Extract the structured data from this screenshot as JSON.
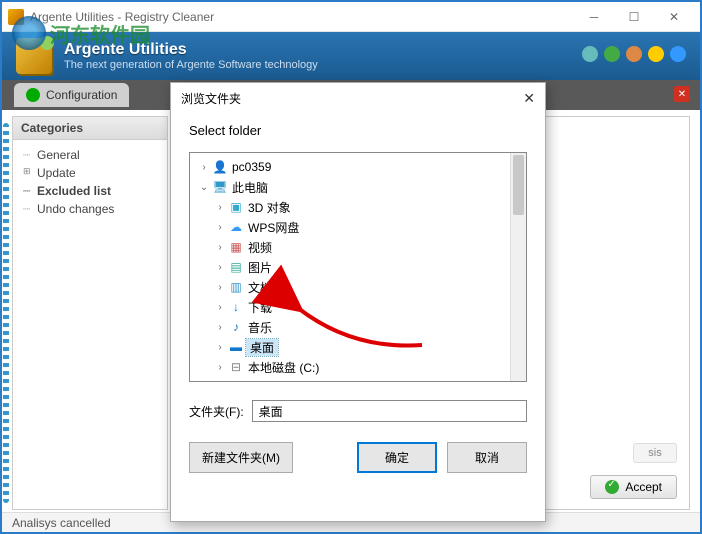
{
  "window": {
    "title": "Argente Utilities - Registry Cleaner",
    "min": "─",
    "max": "☐",
    "close": "✕"
  },
  "watermark": {
    "text": "河东软件园"
  },
  "banner": {
    "title": "Argente Utilities",
    "subtitle": "The next generation of Argente Software technology"
  },
  "tab": {
    "label": "Configuration"
  },
  "sidebar": {
    "header": "Categories",
    "items": [
      "General",
      "Update",
      "Excluded list",
      "Undo changes"
    ]
  },
  "content": {
    "accept": "Accept",
    "ghost": "sis"
  },
  "status": {
    "text": "Analisys cancelled"
  },
  "dialog": {
    "title": "浏览文件夹",
    "close": "✕",
    "heading": "Select folder",
    "folder_label": "文件夹(F):",
    "folder_value": "桌面",
    "new_folder": "新建文件夹(M)",
    "ok": "确定",
    "cancel": "取消",
    "tree": [
      {
        "depth": 0,
        "exp": "closed",
        "icon": "user",
        "glyph": "👤",
        "label": "pc0359"
      },
      {
        "depth": 0,
        "exp": "open",
        "icon": "pc",
        "glyph": "🖥",
        "label": "此电脑"
      },
      {
        "depth": 1,
        "exp": "closed",
        "icon": "3d",
        "glyph": "▣",
        "label": "3D 对象"
      },
      {
        "depth": 1,
        "exp": "closed",
        "icon": "cloud",
        "glyph": "☁",
        "label": "WPS网盘"
      },
      {
        "depth": 1,
        "exp": "closed",
        "icon": "video",
        "glyph": "▦",
        "label": "视频"
      },
      {
        "depth": 1,
        "exp": "closed",
        "icon": "pic",
        "glyph": "▤",
        "label": "图片"
      },
      {
        "depth": 1,
        "exp": "closed",
        "icon": "doc",
        "glyph": "▥",
        "label": "文档"
      },
      {
        "depth": 1,
        "exp": "closed",
        "icon": "dl",
        "glyph": "↓",
        "label": "下载"
      },
      {
        "depth": 1,
        "exp": "closed",
        "icon": "music",
        "glyph": "♪",
        "label": "音乐"
      },
      {
        "depth": 1,
        "exp": "closed",
        "icon": "desk",
        "glyph": "▬",
        "label": "桌面",
        "selected": true
      },
      {
        "depth": 1,
        "exp": "closed",
        "icon": "disk",
        "glyph": "⊟",
        "label": "本地磁盘 (C:)"
      }
    ]
  }
}
